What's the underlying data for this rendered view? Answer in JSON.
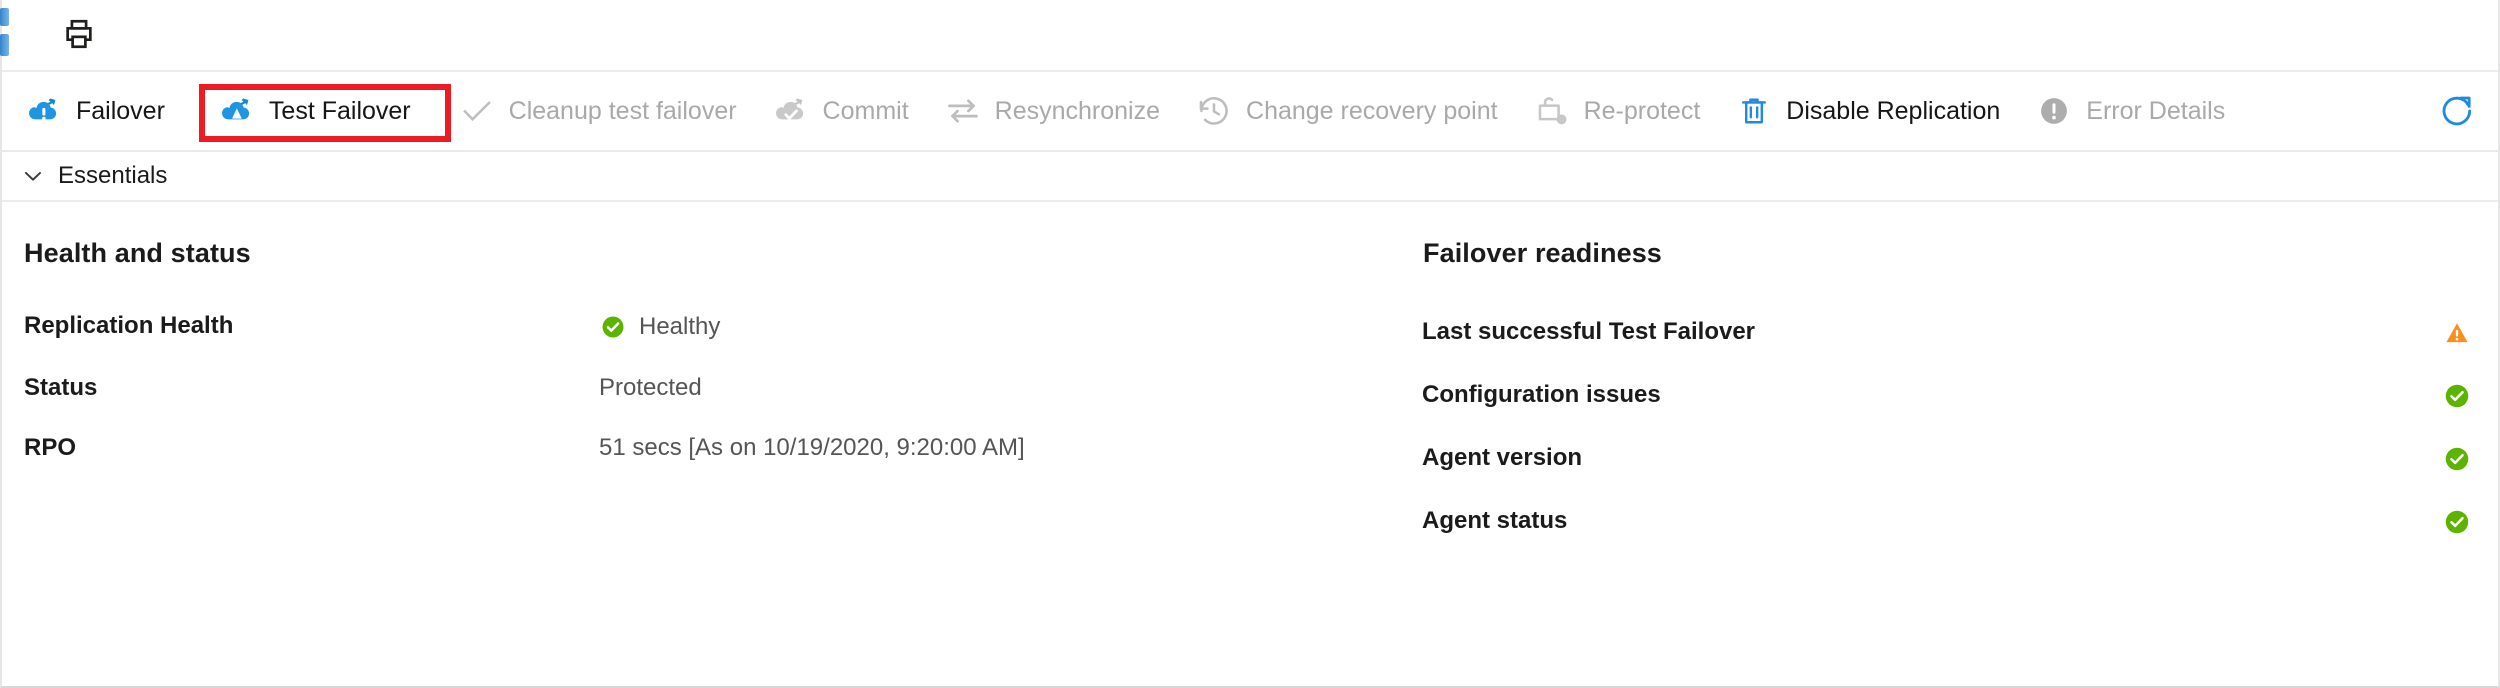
{
  "toolbar_top": {
    "print_label": "Print",
    "print_icon": "printer-icon"
  },
  "command_bar": {
    "commands": [
      {
        "label": "Failover",
        "icon": "failover-cloud-icon",
        "enabled": true,
        "highlighted": false
      },
      {
        "label": "Test Failover",
        "icon": "test-failover-cloud-icon",
        "enabled": true,
        "highlighted": true
      },
      {
        "label": "Cleanup test failover",
        "icon": "checkmark-icon",
        "enabled": false,
        "highlighted": false
      },
      {
        "label": "Commit",
        "icon": "commit-cloud-check-icon",
        "enabled": false,
        "highlighted": false
      },
      {
        "label": "Resynchronize",
        "icon": "resynchronize-arrows-icon",
        "enabled": false,
        "highlighted": false
      },
      {
        "label": "Change recovery point",
        "icon": "clock-history-icon",
        "enabled": false,
        "highlighted": false
      },
      {
        "label": "Re-protect",
        "icon": "re-protect-icon",
        "enabled": false,
        "highlighted": false
      },
      {
        "label": "Disable Replication",
        "icon": "trash-bin-icon",
        "enabled": true,
        "highlighted": false
      },
      {
        "label": "Error Details",
        "icon": "error-exclamation-icon",
        "enabled": false,
        "highlighted": false
      }
    ],
    "refresh_label": "Refresh",
    "refresh_icon": "refresh-icon",
    "highlight_color": "#ec1c24"
  },
  "essentials": {
    "label": "Essentials",
    "chevron_icon": "chevron-down-icon",
    "expanded": true
  },
  "health_and_status": {
    "title": "Health and status",
    "rows": [
      {
        "key": "Replication Health",
        "value": "Healthy",
        "status_icon": "check-circle-green-icon"
      },
      {
        "key": "Status",
        "value": "Protected",
        "status_icon": ""
      },
      {
        "key": "RPO",
        "value": "51 secs [As on 10/19/2020, 9:20:00 AM]",
        "status_icon": ""
      }
    ]
  },
  "failover_readiness": {
    "title": "Failover readiness",
    "rows": [
      {
        "key": "Last successful Test Failover",
        "badge_icon": "warning-triangle-orange-icon"
      },
      {
        "key": "Configuration issues",
        "badge_icon": "check-circle-green-icon"
      },
      {
        "key": "Agent version",
        "badge_icon": "check-circle-green-icon"
      },
      {
        "key": "Agent status",
        "badge_icon": "check-circle-green-icon"
      }
    ]
  },
  "colors": {
    "accent_blue": "#0078d4",
    "success_green": "#5cb400",
    "warning_orange": "#f7901e",
    "disabled_gray": "#a9a9a9",
    "highlight_red": "#ec1c24"
  }
}
